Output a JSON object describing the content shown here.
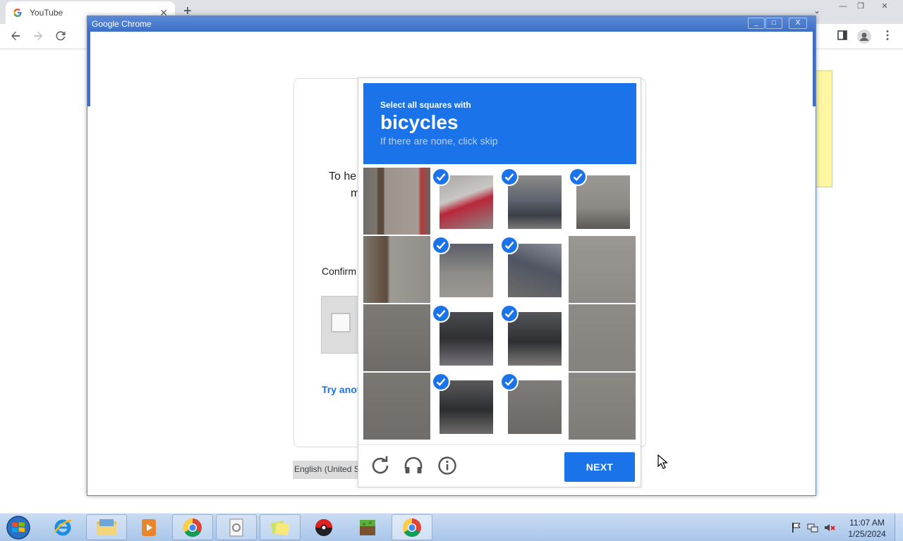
{
  "browser_bg": {
    "tab_title": "YouTube",
    "tab_close": "✕",
    "new_tab": "+",
    "tab_list": "⌄",
    "win_minimize": "—",
    "win_restore": "❐",
    "win_close": "✕"
  },
  "popup": {
    "title": "Google Chrome",
    "minimize": "_",
    "maximize": "□",
    "close": "X"
  },
  "signin_page": {
    "text_line1": "To he",
    "text_line2": "m",
    "confirm_text": "Confirm",
    "try_another": "Try anot",
    "language": "English (United S"
  },
  "captcha": {
    "instruction_small": "Select all squares with",
    "target_object": "bicycles",
    "instruction_sub": "If there are none, click skip",
    "next_label": "NEXT",
    "selected_tiles": [
      1,
      2,
      3,
      5,
      6,
      9,
      10,
      13,
      14
    ],
    "accent_color": "#1a73e8"
  },
  "taskbar": {
    "time": "11:07 AM",
    "date": "1/25/2024"
  }
}
